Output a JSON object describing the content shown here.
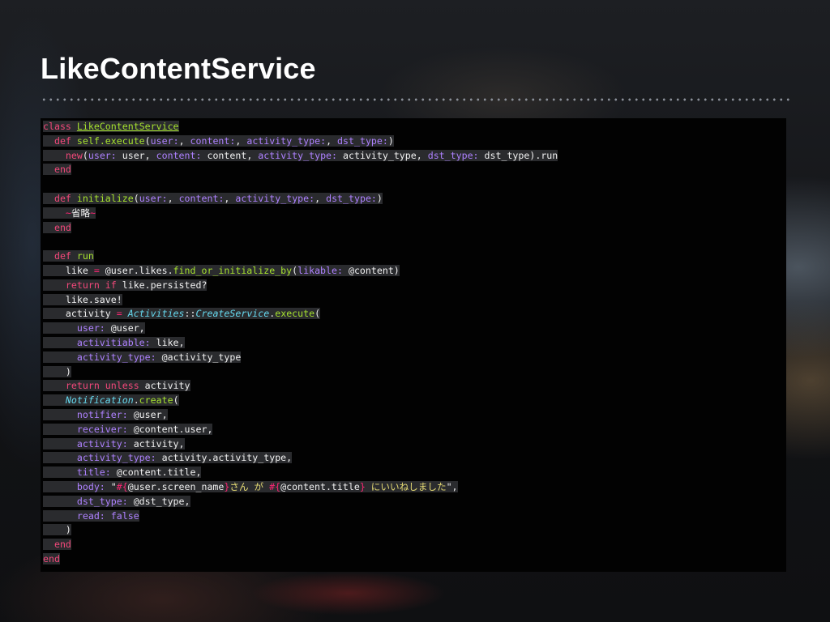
{
  "slide": {
    "title": "LikeContentService"
  },
  "colors": {
    "keyword": "#f2487a",
    "function": "#a6e22e",
    "symbol": "#ae81ff",
    "class_italic": "#66d9ef",
    "string": "#e6db74",
    "text": "#f0f0f0",
    "panel_bg": "#020202"
  },
  "code": {
    "lines": [
      [
        {
          "t": "class",
          "c": "kw"
        },
        {
          "t": " "
        },
        {
          "t": "LikeContentService",
          "c": "cls"
        }
      ],
      [
        {
          "t": "  "
        },
        {
          "t": "def",
          "c": "kw"
        },
        {
          "t": " "
        },
        {
          "t": "self.execute",
          "c": "fn"
        },
        {
          "t": "("
        },
        {
          "t": "user:",
          "c": "sym"
        },
        {
          "t": ", "
        },
        {
          "t": "content:",
          "c": "sym"
        },
        {
          "t": ", "
        },
        {
          "t": "activity_type:",
          "c": "sym"
        },
        {
          "t": ", "
        },
        {
          "t": "dst_type:",
          "c": "sym"
        },
        {
          "t": ")"
        }
      ],
      [
        {
          "t": "    "
        },
        {
          "t": "new",
          "c": "kw"
        },
        {
          "t": "("
        },
        {
          "t": "user:",
          "c": "sym"
        },
        {
          "t": " user, "
        },
        {
          "t": "content:",
          "c": "sym"
        },
        {
          "t": " content, "
        },
        {
          "t": "activity_type:",
          "c": "sym"
        },
        {
          "t": " activity_type, "
        },
        {
          "t": "dst_type:",
          "c": "sym"
        },
        {
          "t": " dst_type)."
        },
        {
          "t": "run"
        }
      ],
      [
        {
          "t": "  "
        },
        {
          "t": "end",
          "c": "kw"
        }
      ],
      [],
      [
        {
          "t": "  "
        },
        {
          "t": "def",
          "c": "kw"
        },
        {
          "t": " "
        },
        {
          "t": "initialize",
          "c": "fn"
        },
        {
          "t": "("
        },
        {
          "t": "user:",
          "c": "sym"
        },
        {
          "t": ", "
        },
        {
          "t": "content:",
          "c": "sym"
        },
        {
          "t": ", "
        },
        {
          "t": "activity_type:",
          "c": "sym"
        },
        {
          "t": ", "
        },
        {
          "t": "dst_type:",
          "c": "sym"
        },
        {
          "t": ")"
        }
      ],
      [
        {
          "t": "    "
        },
        {
          "t": "~",
          "c": "op"
        },
        {
          "t": "省略"
        },
        {
          "t": "~",
          "c": "op"
        }
      ],
      [
        {
          "t": "  "
        },
        {
          "t": "end",
          "c": "kw"
        }
      ],
      [],
      [
        {
          "t": "  "
        },
        {
          "t": "def",
          "c": "kw"
        },
        {
          "t": " "
        },
        {
          "t": "run",
          "c": "fn"
        }
      ],
      [
        {
          "t": "    like "
        },
        {
          "t": "=",
          "c": "op"
        },
        {
          "t": " @user.likes."
        },
        {
          "t": "find_or_initialize_by",
          "c": "fn"
        },
        {
          "t": "("
        },
        {
          "t": "likable:",
          "c": "sym"
        },
        {
          "t": " @content)"
        }
      ],
      [
        {
          "t": "    "
        },
        {
          "t": "return",
          "c": "kw"
        },
        {
          "t": " "
        },
        {
          "t": "if",
          "c": "kw"
        },
        {
          "t": " like.persisted?"
        }
      ],
      [
        {
          "t": "    like.save!"
        }
      ],
      [
        {
          "t": "    activity "
        },
        {
          "t": "=",
          "c": "op"
        },
        {
          "t": " "
        },
        {
          "t": "Activities",
          "c": "ital"
        },
        {
          "t": "::"
        },
        {
          "t": "CreateService",
          "c": "ital"
        },
        {
          "t": "."
        },
        {
          "t": "execute",
          "c": "fn"
        },
        {
          "t": "("
        }
      ],
      [
        {
          "t": "      "
        },
        {
          "t": "user:",
          "c": "sym"
        },
        {
          "t": " @user,"
        }
      ],
      [
        {
          "t": "      "
        },
        {
          "t": "activitiable:",
          "c": "sym"
        },
        {
          "t": " like,"
        }
      ],
      [
        {
          "t": "      "
        },
        {
          "t": "activity_type:",
          "c": "sym"
        },
        {
          "t": " @activity_type"
        }
      ],
      [
        {
          "t": "    )"
        }
      ],
      [
        {
          "t": "    "
        },
        {
          "t": "return",
          "c": "kw"
        },
        {
          "t": " "
        },
        {
          "t": "unless",
          "c": "kw"
        },
        {
          "t": " activity"
        }
      ],
      [
        {
          "t": "    "
        },
        {
          "t": "Notification",
          "c": "ital"
        },
        {
          "t": "."
        },
        {
          "t": "create",
          "c": "fn"
        },
        {
          "t": "("
        }
      ],
      [
        {
          "t": "      "
        },
        {
          "t": "notifier:",
          "c": "sym"
        },
        {
          "t": " @user,"
        }
      ],
      [
        {
          "t": "      "
        },
        {
          "t": "receiver:",
          "c": "sym"
        },
        {
          "t": " @content.user,"
        }
      ],
      [
        {
          "t": "      "
        },
        {
          "t": "activity:",
          "c": "sym"
        },
        {
          "t": " activity,"
        }
      ],
      [
        {
          "t": "      "
        },
        {
          "t": "activity_type:",
          "c": "sym"
        },
        {
          "t": " activity.activity_type,"
        }
      ],
      [
        {
          "t": "      "
        },
        {
          "t": "title:",
          "c": "sym"
        },
        {
          "t": " @content.title,"
        }
      ],
      [
        {
          "t": "      "
        },
        {
          "t": "body:",
          "c": "sym"
        },
        {
          "t": " \""
        },
        {
          "t": "#{",
          "c": "op"
        },
        {
          "t": "@user.screen_name"
        },
        {
          "t": "}",
          "c": "op"
        },
        {
          "t": "さん が ",
          "c": "str"
        },
        {
          "t": "#{",
          "c": "op"
        },
        {
          "t": "@content.title"
        },
        {
          "t": "}",
          "c": "op"
        },
        {
          "t": " にいいねしました",
          "c": "str"
        },
        {
          "t": "\","
        }
      ],
      [
        {
          "t": "      "
        },
        {
          "t": "dst_type:",
          "c": "sym"
        },
        {
          "t": " @dst_type,"
        }
      ],
      [
        {
          "t": "      "
        },
        {
          "t": "read:",
          "c": "sym"
        },
        {
          "t": " "
        },
        {
          "t": "false",
          "c": "sym"
        }
      ],
      [
        {
          "t": "    )"
        }
      ],
      [
        {
          "t": "  "
        },
        {
          "t": "end",
          "c": "kw"
        }
      ],
      [
        {
          "t": "end",
          "c": "kw"
        }
      ]
    ]
  }
}
